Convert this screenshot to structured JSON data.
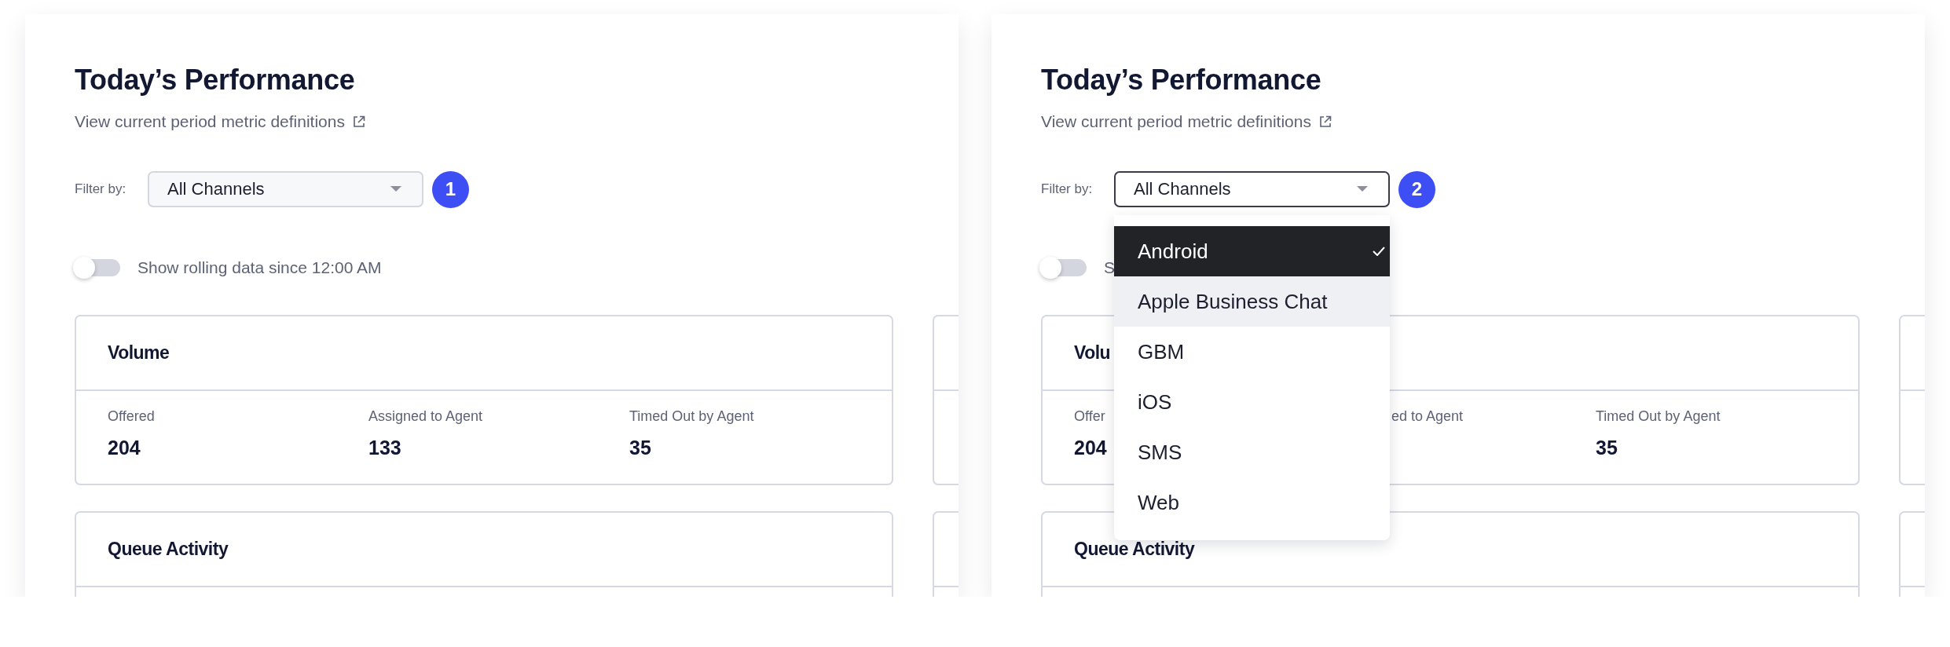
{
  "panels": [
    {
      "title": "Today’s Performance",
      "link": "View current period metric definitions",
      "filter": {
        "label": "Filter by:",
        "value": "All Channels",
        "open": false
      },
      "step_badge": "1",
      "toggle": {
        "label": "Show rolling data since 12:00 AM",
        "on": false
      },
      "cards": [
        {
          "title": "Volume",
          "metrics": [
            {
              "label": "Offered",
              "value": "204"
            },
            {
              "label": "Assigned to Agent",
              "value": "133"
            },
            {
              "label": "Timed Out by Agent",
              "value": "35"
            }
          ]
        },
        {
          "title": "Queue Activity"
        }
      ]
    },
    {
      "title": "Today’s Performance",
      "link": "View current period metric definitions",
      "filter": {
        "label": "Filter by:",
        "value": "All Channels",
        "open": true,
        "options": [
          {
            "label": "Android",
            "selected": true,
            "highlighted": false
          },
          {
            "label": "Apple Business Chat",
            "selected": false,
            "highlighted": true
          },
          {
            "label": "GBM",
            "selected": false,
            "highlighted": false
          },
          {
            "label": "iOS",
            "selected": false,
            "highlighted": false
          },
          {
            "label": "SMS",
            "selected": false,
            "highlighted": false
          },
          {
            "label": "Web",
            "selected": false,
            "highlighted": false
          }
        ]
      },
      "step_badge": "2",
      "toggle": {
        "label": "S",
        "on": false
      },
      "cards": [
        {
          "title": "Volu",
          "metrics": [
            {
              "label": "Offer",
              "value": "204"
            },
            {
              "label": "ed to Agent"
            },
            {
              "label": "Timed Out by Agent",
              "value": "35"
            }
          ]
        },
        {
          "title": "Queue Activity"
        }
      ]
    }
  ]
}
